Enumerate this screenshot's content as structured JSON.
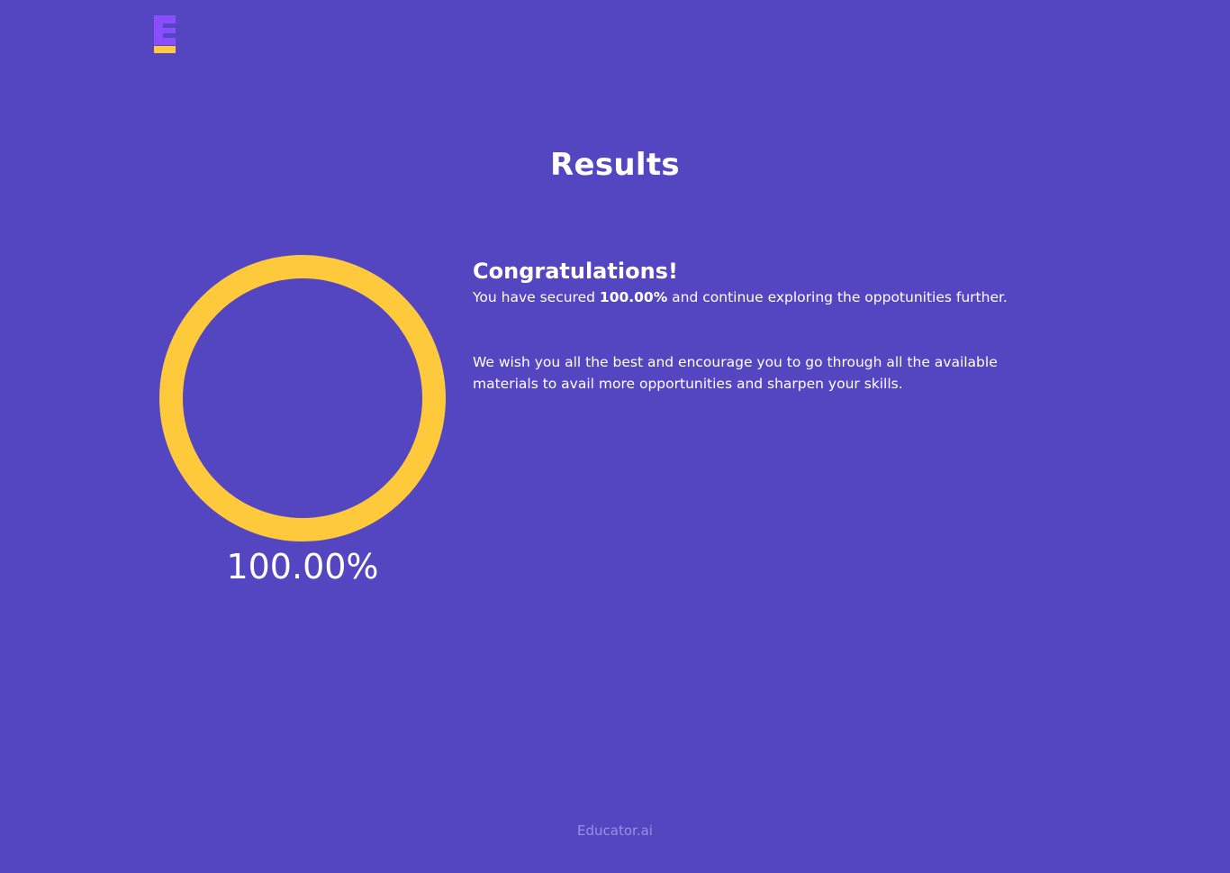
{
  "logo": {
    "name": "educator-logo-icon"
  },
  "page": {
    "title": "Results"
  },
  "score": {
    "percent_label": "100.00%",
    "progress_fraction": 1.0,
    "ring_color": "#ffc93c",
    "track_color": "#5446c1"
  },
  "message": {
    "heading": "Congratulations!",
    "secured_prefix": "You have secured ",
    "secured_value": "100.00%",
    "secured_suffix": " and continue exploring the oppotunities further.",
    "wish_text": "We wish you all the best and encourage you to go through all the available materials to avail more opportunities and sharpen your skills."
  },
  "footer": {
    "brand": "Educator.ai"
  },
  "colors": {
    "background": "#5446c1",
    "accent_yellow": "#ffc93c",
    "logo_purple": "#8a4dff",
    "footer_text": "#9a90e0"
  }
}
